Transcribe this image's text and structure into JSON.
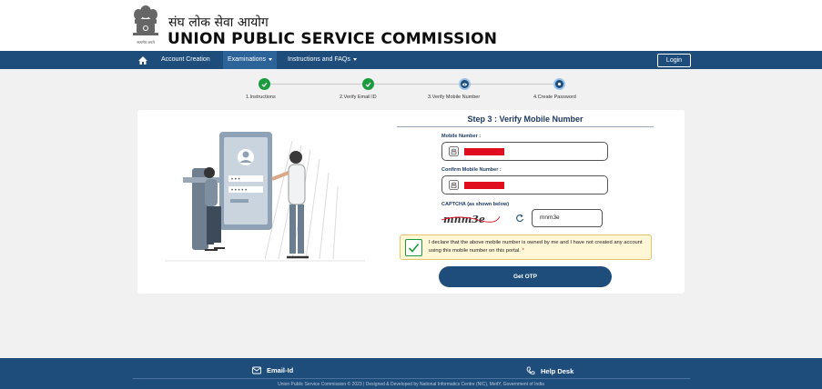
{
  "header": {
    "hindi_title": "संघ लोक सेवा आयोग",
    "english_title": "UNION PUBLIC SERVICE COMMISSION",
    "emblem_caption": "सत्यमेव जयते"
  },
  "nav": {
    "home_icon": "home-icon",
    "items": [
      {
        "label": "Account Creation"
      },
      {
        "label": "Examinations"
      },
      {
        "label": "Instructions and FAQs"
      }
    ],
    "login_label": "Login"
  },
  "stepper": {
    "steps": [
      {
        "label": "1.Instructions",
        "status": "done"
      },
      {
        "label": "2.Verify Email ID",
        "status": "done"
      },
      {
        "label": "3.Verify Mobile Number",
        "status": "current"
      },
      {
        "label": "4.Create Password",
        "status": "pending"
      }
    ]
  },
  "form": {
    "title": "Step 3 : Verify Mobile Number",
    "mobile_label": "Mobile Number :",
    "confirm_label": "Confirm Mobile Number :",
    "captcha_label": "CAPTCHA (as shown below)",
    "captcha_image_text": "mnm3e",
    "captcha_value": "mnm3e",
    "declaration": "I declare that the above mobile number is owned by me and I have not created any account using this mobile number on this portal.",
    "required_mark": "*",
    "otp_button": "Get OTP"
  },
  "footer": {
    "email_label": "Email-Id",
    "helpdesk_label": "Help Desk",
    "copyright": "Union Public Service Commission © 2023 | Designed & Developed by National Informatics Centre (NIC), MeitY, Government of India"
  },
  "colors": {
    "primary": "#1e4d7b",
    "success": "#1a9b3e",
    "redaction": "#e00d1e",
    "declaration_bg": "#fff7d6"
  }
}
